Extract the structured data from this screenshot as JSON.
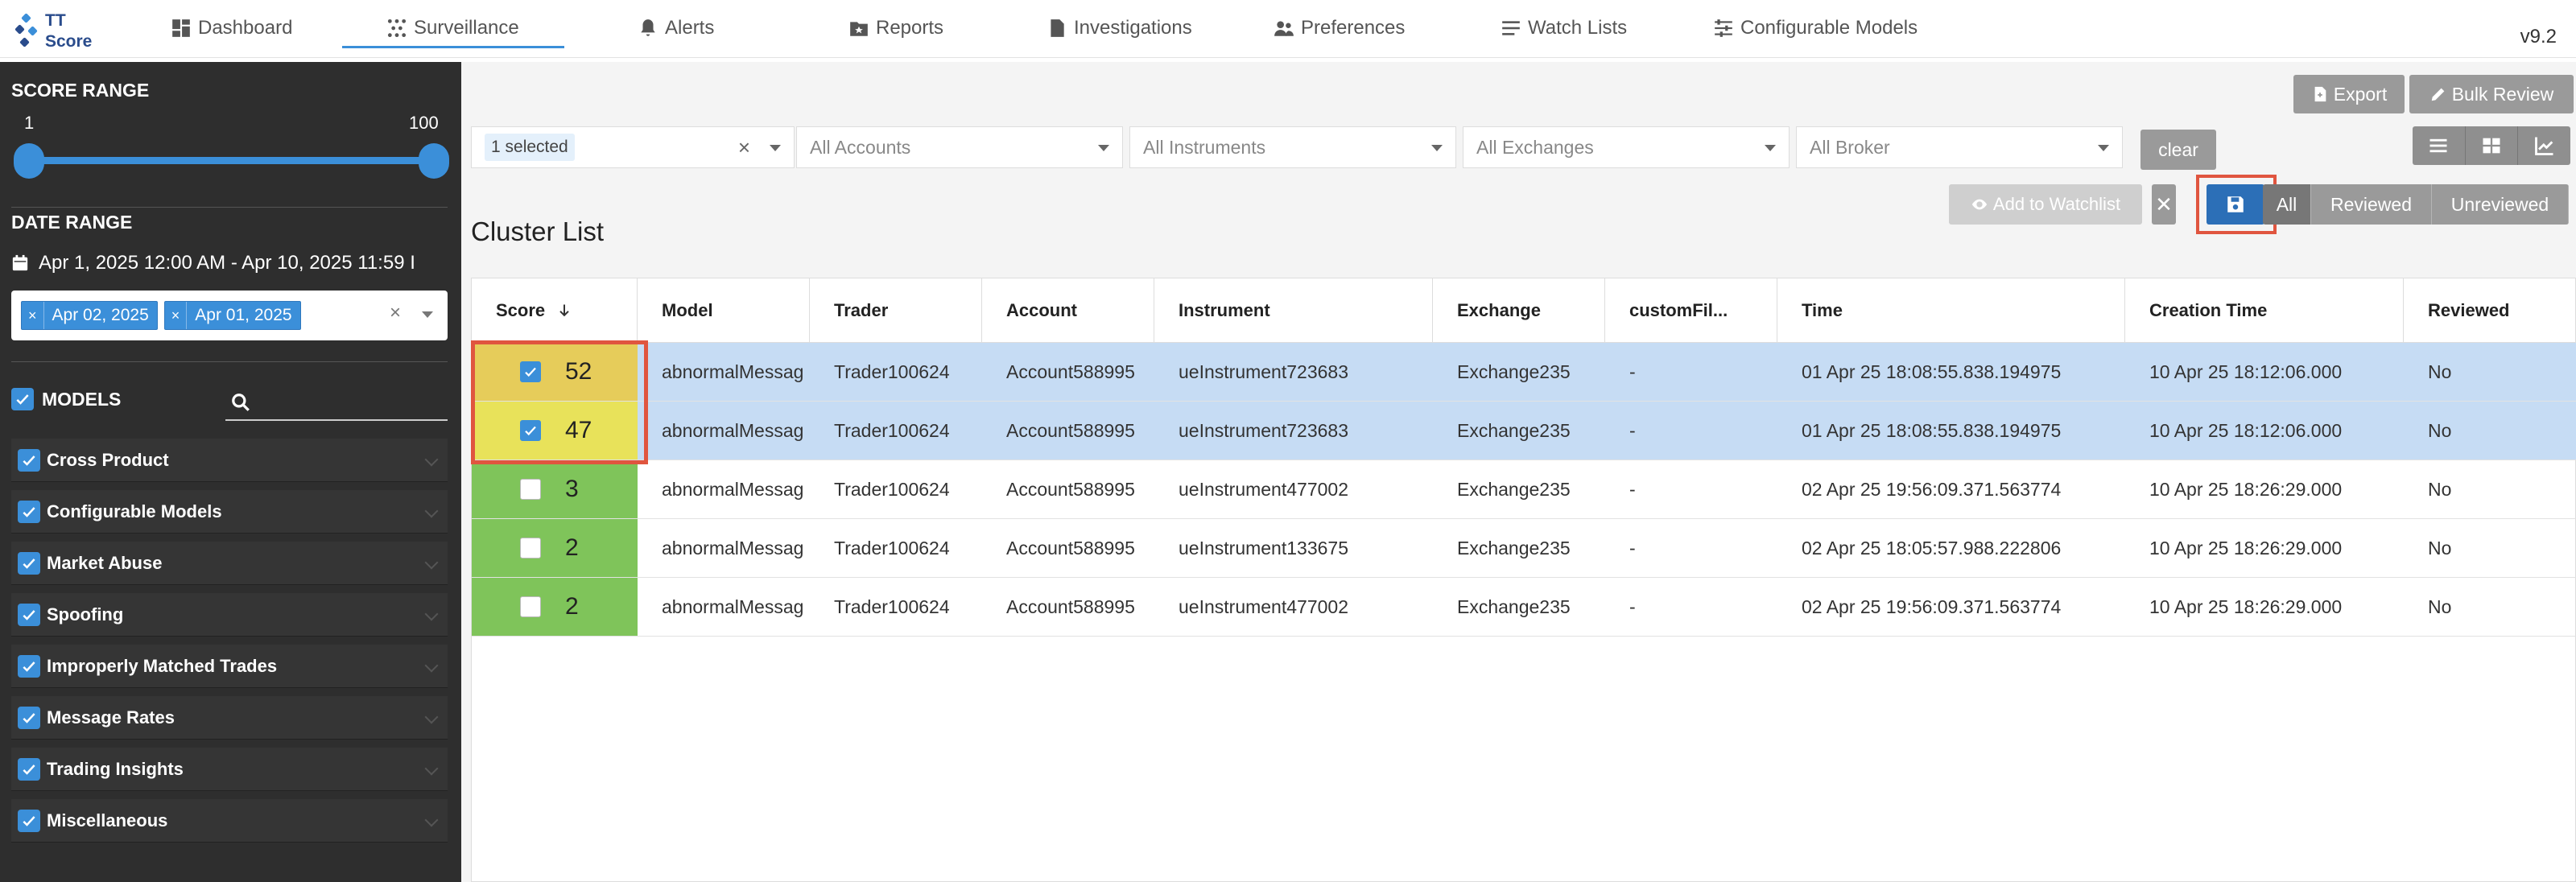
{
  "app": {
    "logo_line1": "TT",
    "logo_line2": "Score",
    "version": "v9.2"
  },
  "nav": [
    {
      "label": "Dashboard",
      "icon": "dashboard-icon"
    },
    {
      "label": "Surveillance",
      "icon": "surveillance-icon",
      "active": true
    },
    {
      "label": "Alerts",
      "icon": "bell-icon"
    },
    {
      "label": "Reports",
      "icon": "reports-icon"
    },
    {
      "label": "Investigations",
      "icon": "document-icon"
    },
    {
      "label": "Preferences",
      "icon": "users-icon"
    },
    {
      "label": "Watch Lists",
      "icon": "list-icon"
    },
    {
      "label": "Configurable Models",
      "icon": "sliders-icon"
    }
  ],
  "sidebar": {
    "score_range": {
      "title": "SCORE RANGE",
      "min": "1",
      "max": "100",
      "low_value": 1,
      "high_value": 100
    },
    "date_range": {
      "title": "DATE RANGE",
      "text": "Apr 1, 2025 12:00 AM - Apr 10, 2025 11:59 I",
      "tags": [
        "Apr 02, 2025",
        "Apr 01, 2025"
      ],
      "clear_glyph": "×"
    },
    "models": {
      "title": "MODELS",
      "search_placeholder": "",
      "items": [
        "Cross Product",
        "Configurable Models",
        "Market Abuse",
        "Spoofing",
        "Improperly Matched Trades",
        "Message Rates",
        "Trading Insights",
        "Miscellaneous"
      ]
    }
  },
  "toolbar": {
    "export_label": "Export",
    "bulk_review_label": "Bulk Review",
    "filters": {
      "selected_pill": "1 selected",
      "accounts": "All Accounts",
      "instruments": "All Instruments",
      "exchanges": "All Exchanges",
      "broker": "All Broker"
    },
    "clear_label": "clear",
    "add_to_watchlist_label": "Add to Watchlist",
    "close_glyph": "✕",
    "tabs": [
      "All",
      "Reviewed",
      "Unreviewed"
    ]
  },
  "cluster_list": {
    "title": "Cluster List",
    "columns": [
      "Score",
      "Model",
      "Trader",
      "Account",
      "Instrument",
      "Exchange",
      "customFil...",
      "Time",
      "Creation Time",
      "Reviewed"
    ],
    "rows": [
      {
        "score": "52",
        "checked": true,
        "model": "abnormalMessag",
        "trader": "Trader100624",
        "account": "Account588995",
        "instrument": "ueInstrument723683",
        "exchange": "Exchange235",
        "custom": "-",
        "time": "01 Apr 25 18:08:55.838.194975",
        "creation_time": "10 Apr 25 18:12:06.000",
        "reviewed": "No",
        "color": "#e6cc5a"
      },
      {
        "score": "47",
        "checked": true,
        "model": "abnormalMessag",
        "trader": "Trader100624",
        "account": "Account588995",
        "instrument": "ueInstrument723683",
        "exchange": "Exchange235",
        "custom": "-",
        "time": "01 Apr 25 18:08:55.838.194975",
        "creation_time": "10 Apr 25 18:12:06.000",
        "reviewed": "No",
        "color": "#e8e25a"
      },
      {
        "score": "3",
        "checked": false,
        "model": "abnormalMessag",
        "trader": "Trader100624",
        "account": "Account588995",
        "instrument": "ueInstrument477002",
        "exchange": "Exchange235",
        "custom": "-",
        "time": "02 Apr 25 19:56:09.371.563774",
        "creation_time": "10 Apr 25 18:26:29.000",
        "reviewed": "No",
        "color": "#7fc45a"
      },
      {
        "score": "2",
        "checked": false,
        "model": "abnormalMessag",
        "trader": "Trader100624",
        "account": "Account588995",
        "instrument": "ueInstrument133675",
        "exchange": "Exchange235",
        "custom": "-",
        "time": "02 Apr 25 18:05:57.988.222806",
        "creation_time": "10 Apr 25 18:26:29.000",
        "reviewed": "No",
        "color": "#7fc45a"
      },
      {
        "score": "2",
        "checked": false,
        "model": "abnormalMessag",
        "trader": "Trader100624",
        "account": "Account588995",
        "instrument": "ueInstrument477002",
        "exchange": "Exchange235",
        "custom": "-",
        "time": "02 Apr 25 19:56:09.371.563774",
        "creation_time": "10 Apr 25 18:26:29.000",
        "reviewed": "No",
        "color": "#7fc45a"
      }
    ]
  },
  "colors": {
    "accent": "#3b8fd9",
    "sidebar_bg": "#2e2e2e",
    "highlight": "#e0553f",
    "selected_row": "#c6dcf4",
    "save_button": "#2c6fb7"
  }
}
